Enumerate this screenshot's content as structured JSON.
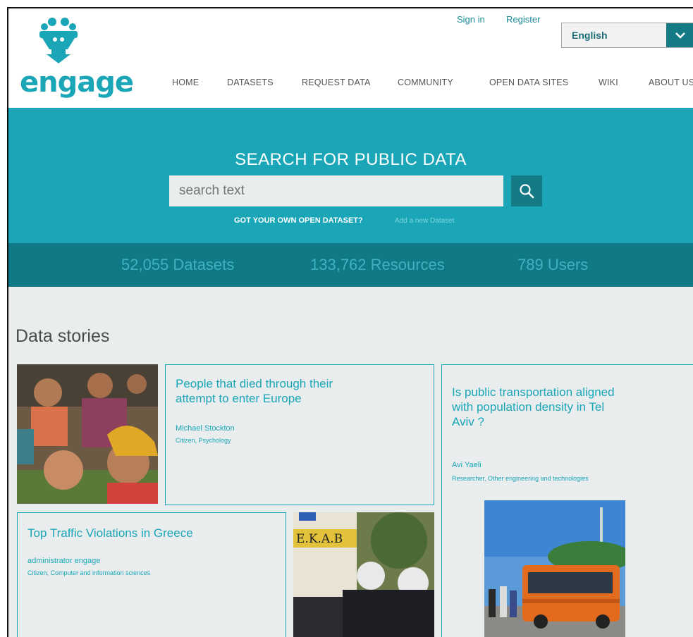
{
  "header": {
    "logo_text": "engage",
    "sign_in": "Sign in",
    "register": "Register",
    "language": {
      "selected": "English",
      "chevron_icon": "chevron-down-icon"
    }
  },
  "nav": {
    "items": [
      "HOME",
      "DATASETS",
      "REQUEST DATA",
      "COMMUNITY",
      "OPEN DATA SITES",
      "WIKI",
      "ABOUT US"
    ]
  },
  "search": {
    "title": "SEARCH FOR PUBLIC DATA",
    "placeholder": "search text",
    "own_dataset": "GOT YOUR OWN OPEN DATASET?",
    "add_link": "Add a new Dataset",
    "button_icon": "search-icon"
  },
  "stats": {
    "datasets": "52,055 Datasets",
    "resources": "133,762 Resources",
    "users": "789 Users"
  },
  "stories": {
    "section_title": "Data stories",
    "items": [
      {
        "title_line1": "People that died through their",
        "title_line2": "attempt to enter Europe",
        "author": "Michael Stockton",
        "role": "Citizen, Psychology"
      },
      {
        "title_line1": "Is public transportation aligned",
        "title_line2": "with population density in Tel",
        "title_line3": "Aviv ?",
        "author": "Avi Yaeli",
        "role": "Researcher, Other engineering and technologies"
      },
      {
        "title": "Top Traffic Violations in Greece",
        "author": "administrator engage",
        "role": "Citizen, Computer and information sciences",
        "ambulance_text": "E.K.A.B"
      }
    ]
  },
  "colors": {
    "teal": "#1aa6b7",
    "dark_teal": "#0f7a86",
    "content_bg": "#e9edee"
  }
}
